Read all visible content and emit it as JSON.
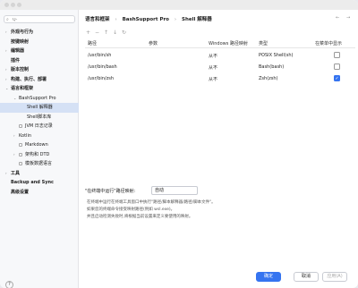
{
  "search": {
    "placeholder": "Q-"
  },
  "sidebar": {
    "items": [
      {
        "label": "外观与行为",
        "bold": true,
        "chev": "›",
        "indent": 0
      },
      {
        "label": "按键映射",
        "bold": true,
        "chev": "",
        "indent": 0
      },
      {
        "label": "编辑器",
        "bold": true,
        "chev": "›",
        "indent": 0
      },
      {
        "label": "插件",
        "bold": true,
        "chev": "",
        "indent": 0
      },
      {
        "label": "版本控制",
        "bold": true,
        "chev": "›",
        "indent": 0
      },
      {
        "label": "构建、执行、部署",
        "bold": true,
        "chev": "›",
        "indent": 0
      },
      {
        "label": "语言和框架",
        "bold": true,
        "chev": "⌄",
        "indent": 0
      },
      {
        "label": "BashSupport Pro",
        "bold": false,
        "chev": "⌄",
        "indent": 1
      },
      {
        "label": "Shell 解释器",
        "bold": false,
        "chev": "",
        "indent": 2,
        "selected": true
      },
      {
        "label": "Shell脚本库",
        "bold": false,
        "chev": "",
        "indent": 2
      },
      {
        "label": "JVM 日志记录",
        "bold": false,
        "chev": "",
        "indent": 1,
        "square": true
      },
      {
        "label": "Kotlin",
        "bold": false,
        "chev": "›",
        "indent": 1
      },
      {
        "label": "Markdown",
        "bold": false,
        "chev": "",
        "indent": 1,
        "square": true
      },
      {
        "label": "架构和 DTD",
        "bold": false,
        "chev": "›",
        "indent": 1,
        "square": true
      },
      {
        "label": "模板数据语言",
        "bold": false,
        "chev": "",
        "indent": 1,
        "square": true
      },
      {
        "label": "工具",
        "bold": true,
        "chev": "›",
        "indent": 0
      },
      {
        "label": "Backup and Sync",
        "bold": true,
        "chev": "",
        "indent": 0
      },
      {
        "label": "高级设置",
        "bold": true,
        "chev": "",
        "indent": 0
      }
    ]
  },
  "breadcrumb": {
    "part1": "语言和框架",
    "sep": "›",
    "part2": "BashSupport Pro",
    "part3": "Shell 解释器"
  },
  "table": {
    "headers": {
      "path": "路径",
      "params": "参数",
      "winmap": "Windows 路径映射",
      "type": "类型",
      "menu": "在菜单中显示"
    },
    "rows": [
      {
        "path": "/usr/bin/sh",
        "params": "",
        "winmap": "从不",
        "type": "POSIX Shell(sh)",
        "checked": false
      },
      {
        "path": "/usr/bin/bash",
        "params": "",
        "winmap": "从不",
        "type": "Bash(bash)",
        "checked": false
      },
      {
        "path": "/usr/bin/zsh",
        "params": "",
        "winmap": "从不",
        "type": "Zsh(zsh)",
        "checked": true
      }
    ]
  },
  "terminal_path": {
    "label": "\"在终端中运行\"路径映射:",
    "value": "自动"
  },
  "notes": [
    "在终端中运行在终端工具窗口中执行\"路径/脚本解释器/路径/脚本文件\"。",
    "如果您的终端命令接受映射路径(例如 wsl.exe)。",
    "并且启动检测失败时,将根据当前设置来定义要使用的映射。"
  ],
  "footer": {
    "ok": "确定",
    "cancel": "取消",
    "apply": "应用(A)"
  },
  "help": "?"
}
